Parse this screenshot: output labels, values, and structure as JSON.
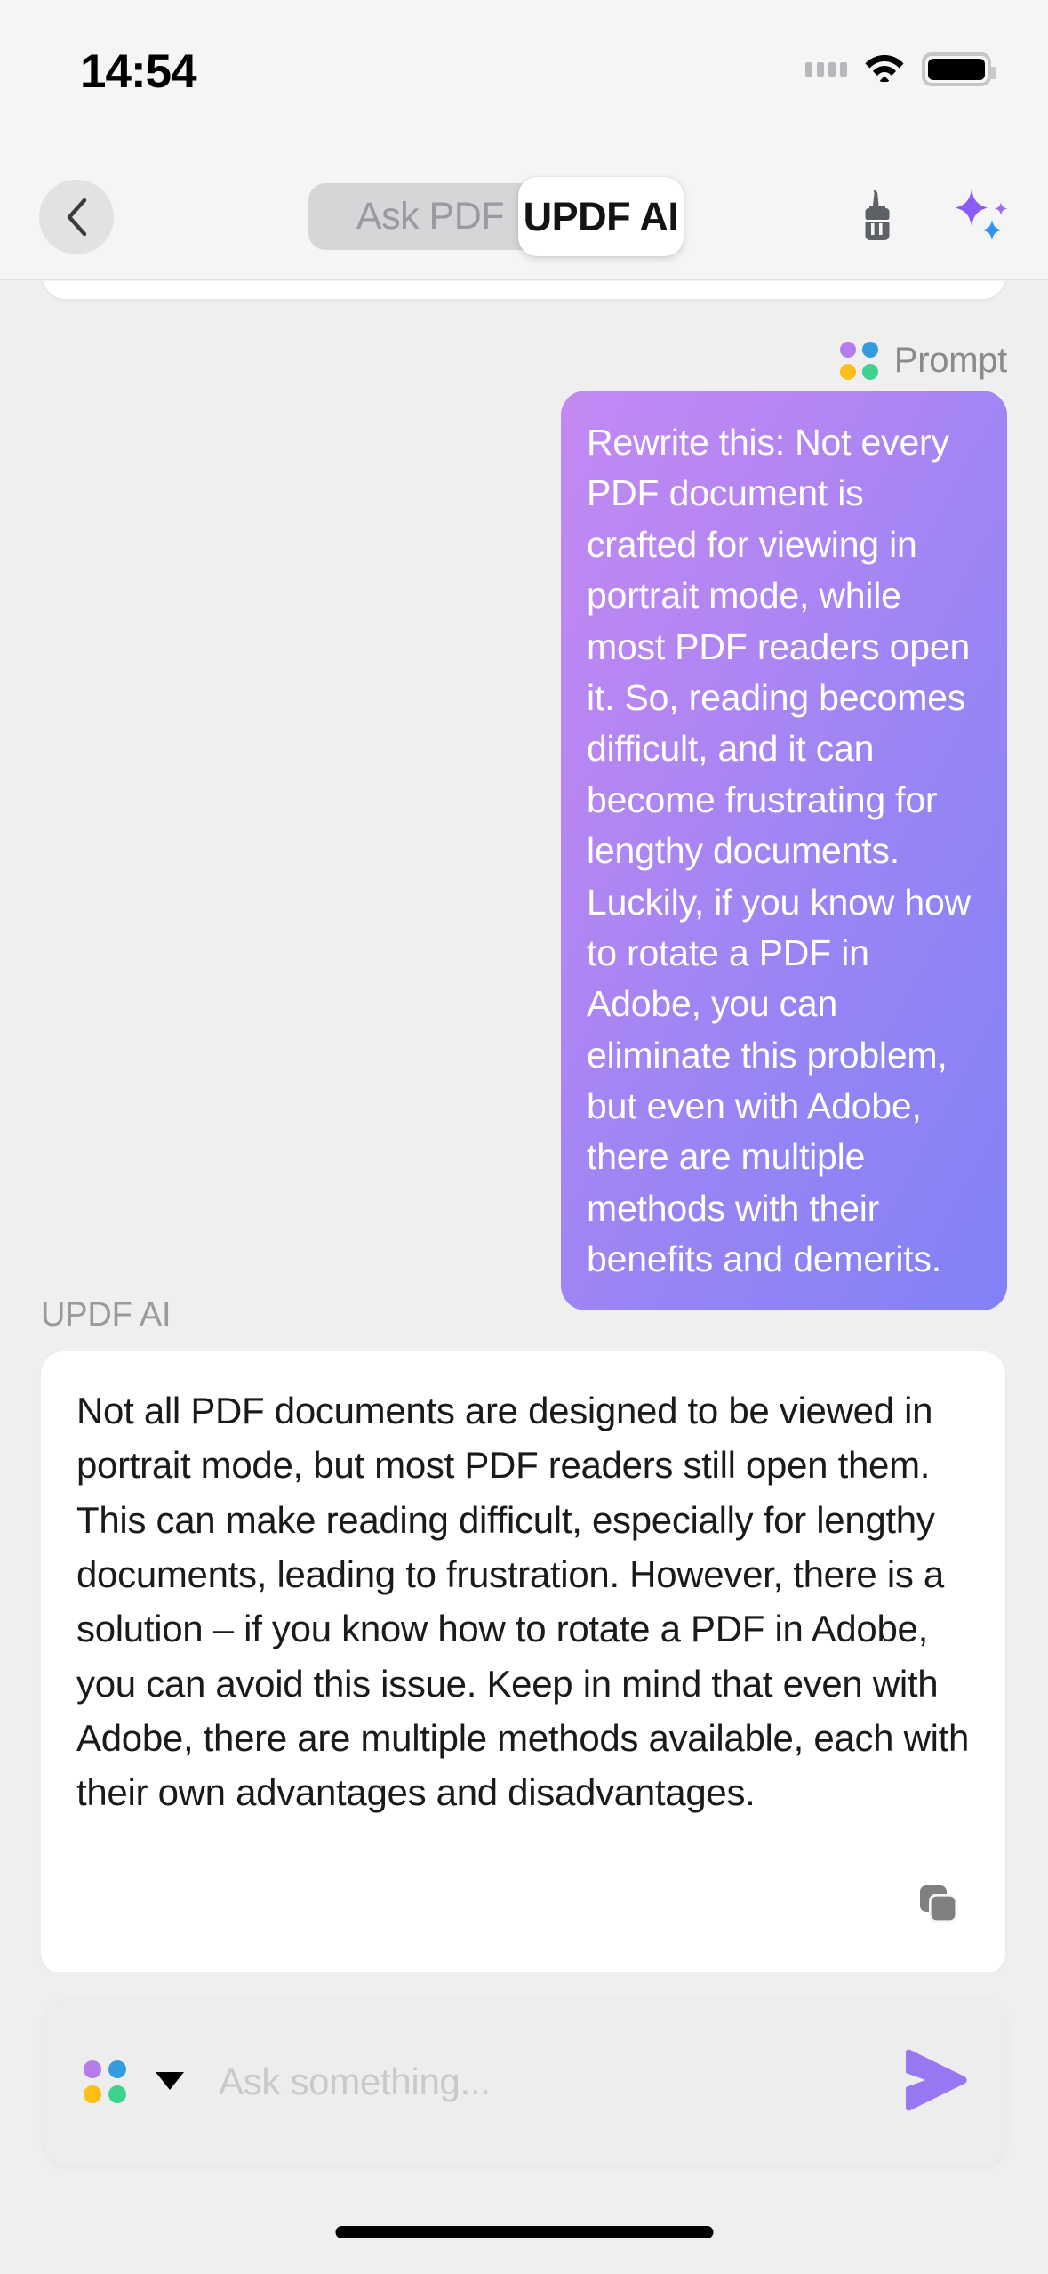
{
  "status_bar": {
    "time": "14:54",
    "signal_icon": "signal-dots-icon",
    "wifi_icon": "wifi-icon",
    "battery_icon": "battery-full-icon"
  },
  "header": {
    "back_icon": "chevron-left-icon",
    "tabs": [
      {
        "label": "Ask PDF",
        "selected": false
      },
      {
        "label": "UPDF AI",
        "selected": true
      }
    ],
    "brush_icon": "brush-icon",
    "ai_sparkle_icon": "sparkles-icon"
  },
  "conversation": {
    "prompt_label": "Prompt",
    "prompt_dots_icon": "four-color-dots-icon",
    "user_message": "Rewrite this: Not every PDF document is crafted for viewing in portrait mode, while most PDF readers open it. So, reading becomes difficult, and it can become frustrating for lengthy documents. Luckily, if you know how to rotate a PDF in Adobe, you can eliminate this problem, but even with Adobe, there are multiple methods with their benefits and demerits.",
    "assistant_label": "UPDF AI",
    "assistant_message": "Not all PDF documents are designed to be viewed in portrait mode, but most PDF readers still open them. This can make reading difficult, especially for lengthy documents, leading to frustration. However, there is a solution – if you know how to rotate a PDF in Adobe, you can avoid this issue. Keep in mind that even with Adobe, there are multiple methods available, each with their own advantages and disadvantages.",
    "copy_icon": "copy-icon"
  },
  "composer": {
    "dots_icon": "four-color-dots-icon",
    "model_caret_icon": "caret-down-icon",
    "input_value": "",
    "input_placeholder": "Ask something...",
    "send_icon": "send-arrow-icon"
  },
  "colors": {
    "page_background": "#EFEFEF",
    "header_background": "#F5F5F5",
    "user_bubble_gradient_start": "#C389F2",
    "user_bubble_gradient_end": "#8082F6",
    "accent_purple": "#8B5CF6",
    "accent_blue": "#329CDE",
    "dot_purple": "#B57BE8",
    "dot_blue": "#329CDE",
    "dot_yellow": "#FBBF18",
    "dot_green": "#3ED28C",
    "send_arrow": "#9778F2",
    "card_white": "#FFFFFF",
    "muted_text": "#8A8A8E"
  }
}
